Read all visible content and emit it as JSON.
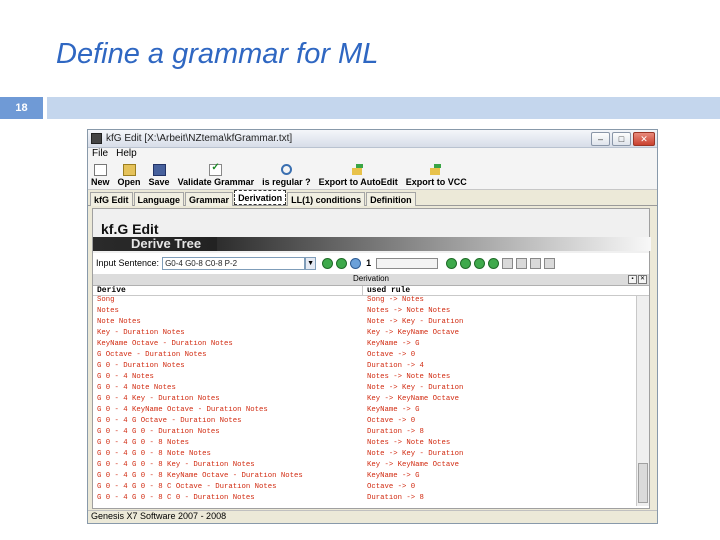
{
  "slide": {
    "title": "Define a grammar for ML",
    "page_number": "18"
  },
  "window": {
    "title": "kfG Edit [X:\\Arbeit\\NZtema\\kfGrammar.txt]",
    "controls": {
      "minimize": "–",
      "maximize": "□",
      "close": "✕"
    }
  },
  "menu": {
    "items": [
      "File",
      "Help"
    ]
  },
  "toolbar": {
    "new": "New",
    "open": "Open",
    "save": "Save",
    "validate": "Validate Grammar",
    "regular": "is regular ?",
    "export_auto": "Export to AutoEdit",
    "export_vcc": "Export to VCC"
  },
  "tabs": [
    "kfG Edit",
    "Language",
    "Grammar",
    "Derivation",
    "LL(1) conditions",
    "Definition"
  ],
  "active_tab": "Derivation",
  "banner": {
    "brand": "kf.G Edit",
    "subtitle": "Derive Tree"
  },
  "input": {
    "label": "Input Sentence:",
    "value": "G0-4 G0-8 C0-8 P-2",
    "counter": "1"
  },
  "derivation": {
    "header": "Derivation",
    "col_derive": "Derive",
    "col_rule": "used rule",
    "rows": [
      [
        "Song",
        "Song -> Notes"
      ],
      [
        "Notes",
        "Notes -> Note Notes"
      ],
      [
        "Note Notes",
        "Note -> Key - Duration"
      ],
      [
        "Key - Duration Notes",
        "Key -> KeyName Octave"
      ],
      [
        "KeyName Octave - Duration Notes",
        "KeyName -> G"
      ],
      [
        "G Octave - Duration Notes",
        "Octave -> 0"
      ],
      [
        "G 0 - Duration Notes",
        "Duration -> 4"
      ],
      [
        "G 0 - 4 Notes",
        "Notes -> Note Notes"
      ],
      [
        "G 0 - 4 Note Notes",
        "Note -> Key - Duration"
      ],
      [
        "G 0 - 4 Key - Duration Notes",
        "Key -> KeyName Octave"
      ],
      [
        "G 0 - 4 KeyName Octave - Duration Notes",
        "KeyName -> G"
      ],
      [
        "G 0 - 4 G Octave - Duration Notes",
        "Octave -> 0"
      ],
      [
        "G 0 - 4 G 0 - Duration Notes",
        "Duration -> 8"
      ],
      [
        "G 0 - 4 G 0 - 8 Notes",
        "Notes -> Note Notes"
      ],
      [
        "G 0 - 4 G 0 - 8 Note Notes",
        "Note -> Key - Duration"
      ],
      [
        "G 0 - 4 G 0 - 8 Key - Duration Notes",
        "Key -> KeyName Octave"
      ],
      [
        "G 0 - 4 G 0 - 8 KeyName Octave - Duration Notes",
        "KeyName -> G"
      ],
      [
        "G 0 - 4 G 0 - 8 C Octave - Duration Notes",
        "Octave -> 0"
      ],
      [
        "G 0 - 4 G 0 - 8 C 0 - Duration Notes",
        "Duration -> 8"
      ]
    ]
  },
  "status": "Genesis X7 Software 2007 - 2008",
  "colors": {
    "slide_title": "#2f67c2",
    "rule_text": "#d12a10",
    "accent_bar": "#6f9ad6"
  }
}
